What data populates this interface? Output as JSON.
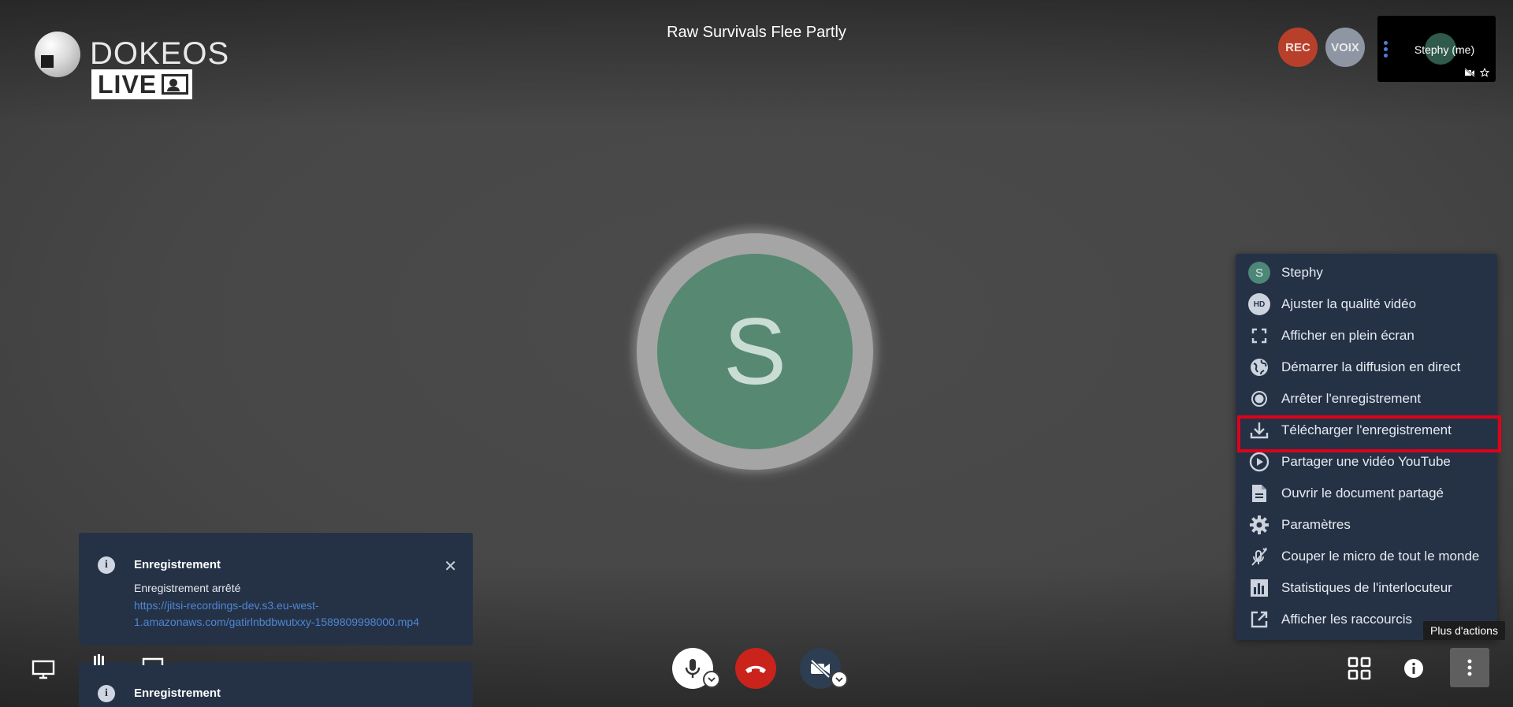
{
  "app": {
    "meeting_title": "Raw Survivals Flee Partly"
  },
  "logo": {
    "brand": "DOKEOS",
    "product": "LIVE"
  },
  "header": {
    "rec_badge": "REC",
    "voice_badge": "VOIX",
    "self_view_name": "Stephy (me)"
  },
  "speaker": {
    "avatar_letter": "S"
  },
  "more_menu": {
    "items": [
      {
        "label": "Stephy",
        "icon": "avatar-icon",
        "initial": "S"
      },
      {
        "label": "Ajuster la qualité vidéo",
        "icon": "hd-quality-icon",
        "badge": "HD"
      },
      {
        "label": "Afficher en plein écran",
        "icon": "fullscreen-icon"
      },
      {
        "label": "Démarrer la diffusion en direct",
        "icon": "globe-icon"
      },
      {
        "label": "Arrêter l'enregistrement",
        "icon": "record-icon"
      },
      {
        "label": "Télécharger l'enregistrement",
        "icon": "download-icon"
      },
      {
        "label": "Partager une vidéo YouTube",
        "icon": "play-icon"
      },
      {
        "label": "Ouvrir le document partagé",
        "icon": "document-icon"
      },
      {
        "label": "Paramètres",
        "icon": "gear-icon"
      },
      {
        "label": "Couper le micro de tout le monde",
        "icon": "mute-everyone-icon"
      },
      {
        "label": "Statistiques de l'interlocuteur",
        "icon": "stats-icon"
      },
      {
        "label": "Afficher les raccourcis",
        "icon": "external-link-icon"
      }
    ],
    "highlight_color": "#e1001a"
  },
  "tooltip": {
    "text": "Plus d'actions"
  },
  "notifications": [
    {
      "title": "Enregistrement",
      "message": "Enregistrement arrêté",
      "link": "https://jitsi-recordings-dev.s3.eu-west-1.amazonaws.com/gatirlnbdbwutxxy-1589809998000.mp4"
    },
    {
      "title": "Enregistrement"
    }
  ],
  "colors": {
    "menu_bg": "#253246",
    "avatar_green": "#578872",
    "hangup_red": "#c9231c",
    "rec_red": "#b8402a"
  }
}
